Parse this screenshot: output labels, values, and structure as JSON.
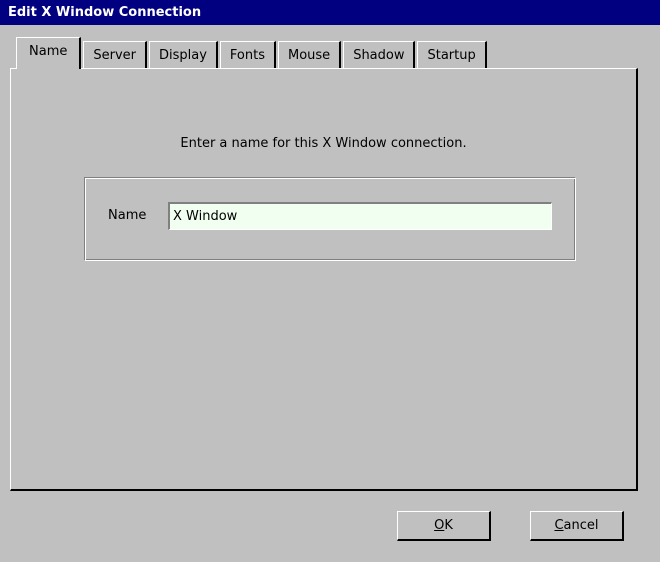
{
  "window": {
    "title": "Edit X Window Connection"
  },
  "tabs": [
    {
      "label": "Name",
      "active": true
    },
    {
      "label": "Server",
      "active": false
    },
    {
      "label": "Display",
      "active": false
    },
    {
      "label": "Fonts",
      "active": false
    },
    {
      "label": "Mouse",
      "active": false
    },
    {
      "label": "Shadow",
      "active": false
    },
    {
      "label": "Startup",
      "active": false
    }
  ],
  "panel": {
    "prompt": "Enter a name for this X Window connection.",
    "name_label": "Name",
    "name_value": "X Window"
  },
  "buttons": {
    "ok_mnemonic": "O",
    "ok_rest": "K",
    "cancel_mnemonic": "C",
    "cancel_rest": "ancel"
  },
  "colors": {
    "titlebar": "#000080",
    "background": "#c0c0c0",
    "input_background": "#f0fff0"
  }
}
